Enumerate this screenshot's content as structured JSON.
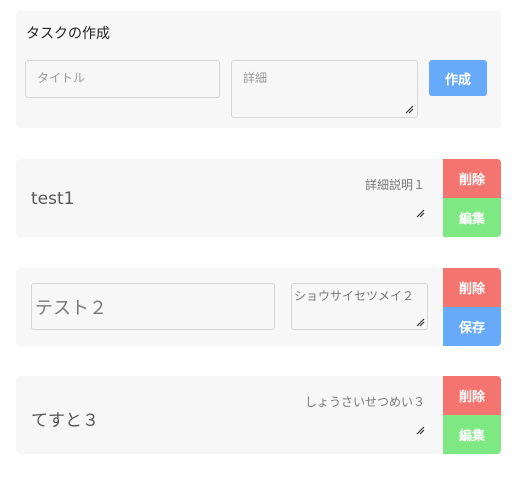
{
  "create": {
    "heading": "タスクの作成",
    "title_placeholder": "タイトル",
    "detail_placeholder": "詳細",
    "create_label": "作成"
  },
  "tasks": [
    {
      "title": "test1",
      "detail": "詳細説明１",
      "delete_label": "削除",
      "action_label": "編集"
    },
    {
      "title": "テスト２",
      "detail": "ショウサイセツメイ２",
      "delete_label": "削除",
      "action_label": "保存"
    },
    {
      "title": "てすと３",
      "detail": "しょうさいせつめい３",
      "delete_label": "削除",
      "action_label": "編集"
    }
  ],
  "colors": {
    "primary": "#67aaf9",
    "danger": "#f47570",
    "success": "#7ee883",
    "card": "#f7f7f7"
  }
}
